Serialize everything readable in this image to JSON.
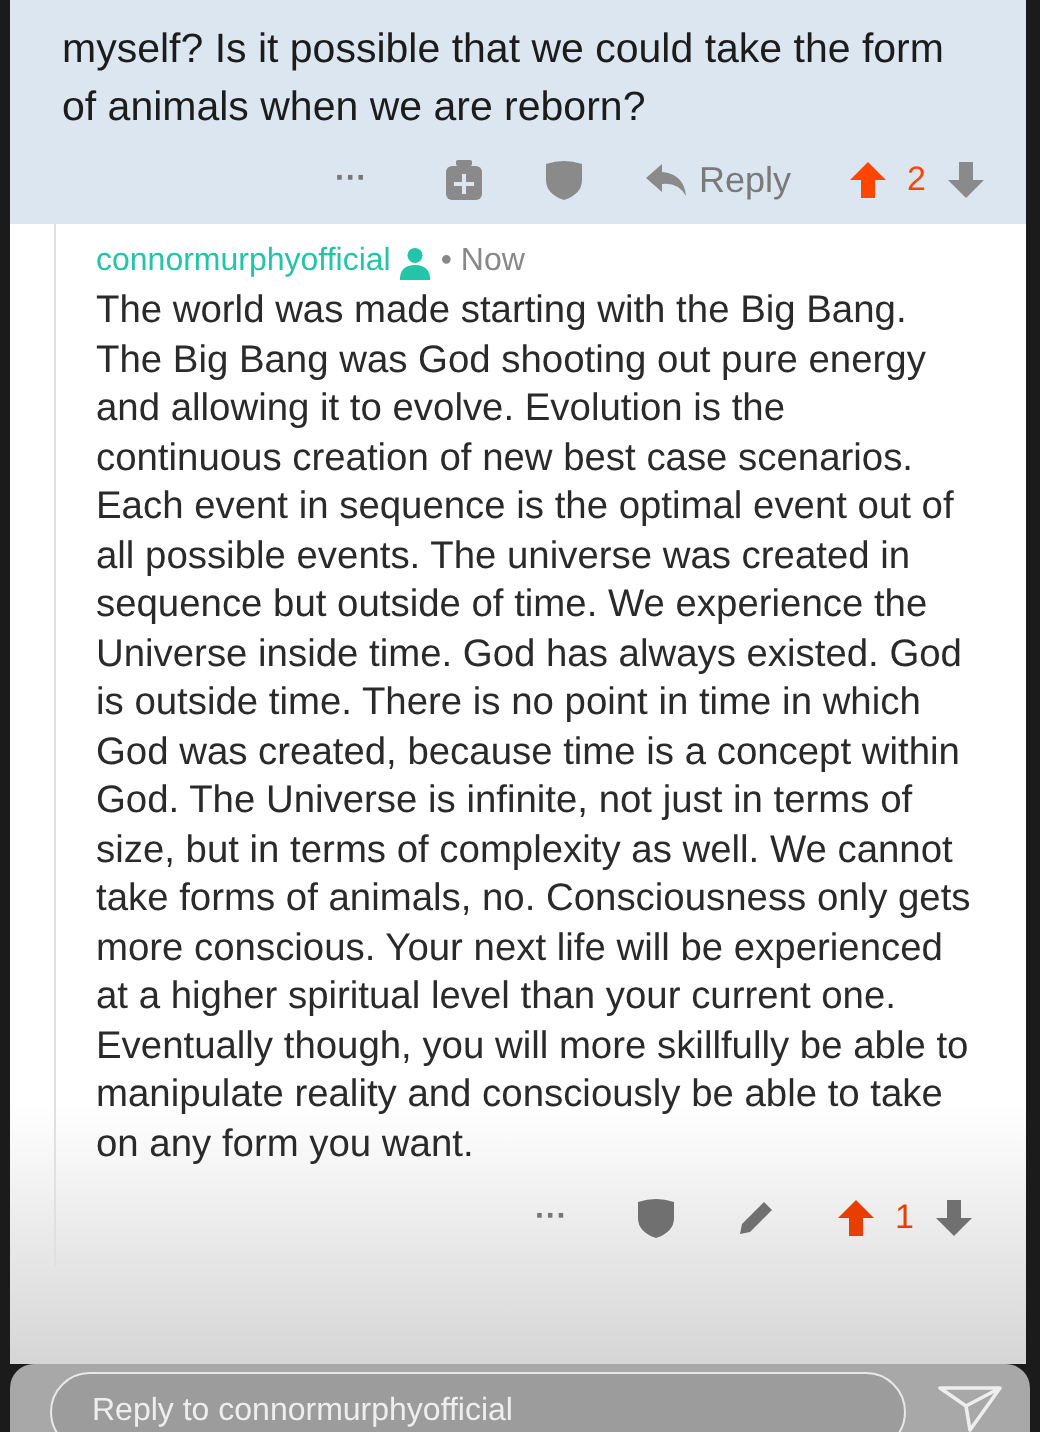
{
  "parent_comment": {
    "text": "myself? Is it possible that we could take the form of animals when we are reborn?",
    "actions": {
      "more": "···",
      "reply": "Reply",
      "votes": "2",
      "upvoted": true
    }
  },
  "reply_comment": {
    "author": "connormurphyofficial",
    "time": "• Now",
    "text": "The world was made starting with the Big Bang. The Big Bang was God shooting out pure energy and allowing it to evolve. Evolution is the continuous creation of new best case scenarios. Each event in sequence is the optimal event out of all possible events. The universe was created in sequence but outside of time. We experience the Universe inside time. God has always existed. God is outside time. There is no point in time in which God was created, because time is a concept within God. The Universe is infinite, not just in terms of size, but in terms of complexity as well. We cannot take forms of animals, no. Consciousness only gets more conscious. Your next life will be experienced at a higher spiritual level than your current one. Eventually though, you will more skillfully be able to manipulate reality and consciously be able to take on any form you want.",
    "actions": {
      "more": "···",
      "votes": "1",
      "upvoted": true
    }
  },
  "reply_bar": {
    "placeholder": "Reply to connormurphyofficial"
  }
}
